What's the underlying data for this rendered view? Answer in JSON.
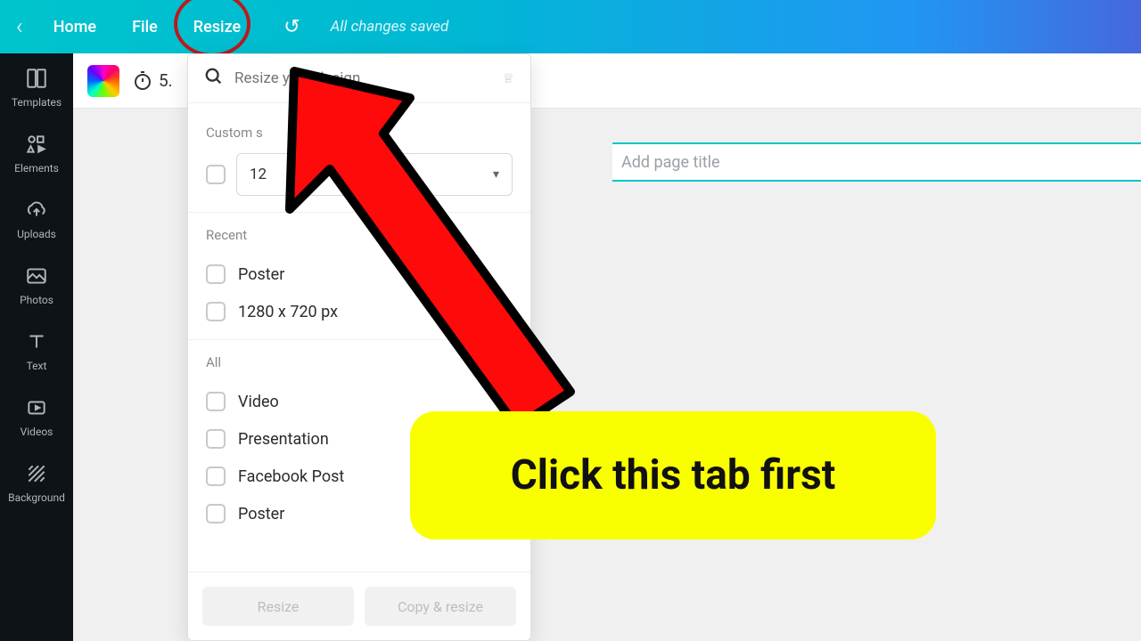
{
  "topbar": {
    "home": "Home",
    "file": "File",
    "resize": "Resize",
    "saved": "All changes saved"
  },
  "sidebar": {
    "items": [
      {
        "label": "Templates"
      },
      {
        "label": "Elements"
      },
      {
        "label": "Uploads"
      },
      {
        "label": "Photos"
      },
      {
        "label": "Text"
      },
      {
        "label": "Videos"
      },
      {
        "label": "Background"
      }
    ]
  },
  "toolbar": {
    "timer_value": "5."
  },
  "resize_panel": {
    "search_placeholder": "Resize your design",
    "custom_label": "Custom s",
    "custom_value": "12",
    "recent_label": "Recent",
    "recent_items": [
      "Poster",
      "1280 x 720 px"
    ],
    "all_label": "All",
    "all_items": [
      "Video",
      "Presentation",
      "Facebook Post",
      "Poster"
    ],
    "resize_btn": "Resize",
    "copy_btn": "Copy & resize"
  },
  "canvas": {
    "page_title_placeholder": "Add page title"
  },
  "annotation": {
    "callout": "Click this tab first"
  }
}
